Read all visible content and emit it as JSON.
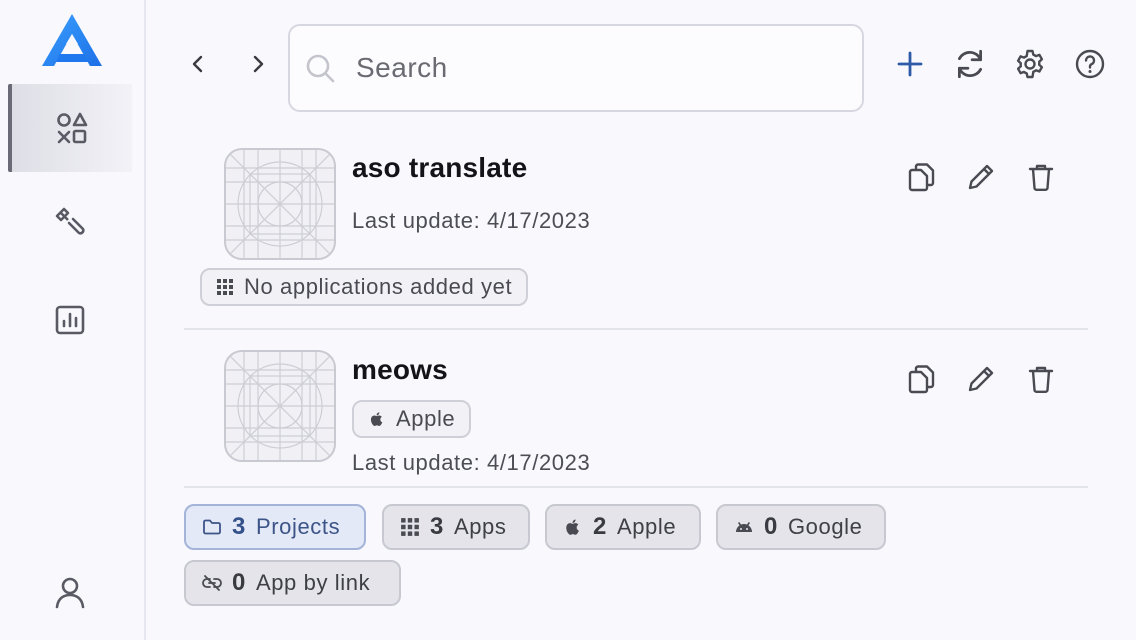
{
  "search": {
    "placeholder": "Search",
    "value": ""
  },
  "projects": [
    {
      "title": "aso translate",
      "last_update_label": "Last update: 4/17/2023",
      "tag_label": "No applications added yet"
    },
    {
      "title": "meows",
      "last_update_label": "Last update: 4/17/2023",
      "tag_label": "Apple"
    }
  ],
  "summary": {
    "projects": {
      "count": "3",
      "label": "Projects"
    },
    "apps": {
      "count": "3",
      "label": "Apps"
    },
    "apple": {
      "count": "2",
      "label": "Apple"
    },
    "google": {
      "count": "0",
      "label": "Google"
    },
    "link": {
      "count": "0",
      "label": "App by link"
    }
  },
  "icons": {
    "logo": "app-logo-icon",
    "apps": "shapes-icon",
    "tools": "wrench-icon",
    "stats": "bar-chart-icon",
    "user": "user-icon",
    "back": "chevron-left-icon",
    "forward": "chevron-right-icon",
    "add": "plus-icon",
    "refresh": "refresh-icon",
    "settings": "gear-icon",
    "help": "help-icon"
  },
  "colors": {
    "accent": "#2f5aa8",
    "logo": "#2d7ff0",
    "chip_active_bg": "#e3e9f7"
  }
}
